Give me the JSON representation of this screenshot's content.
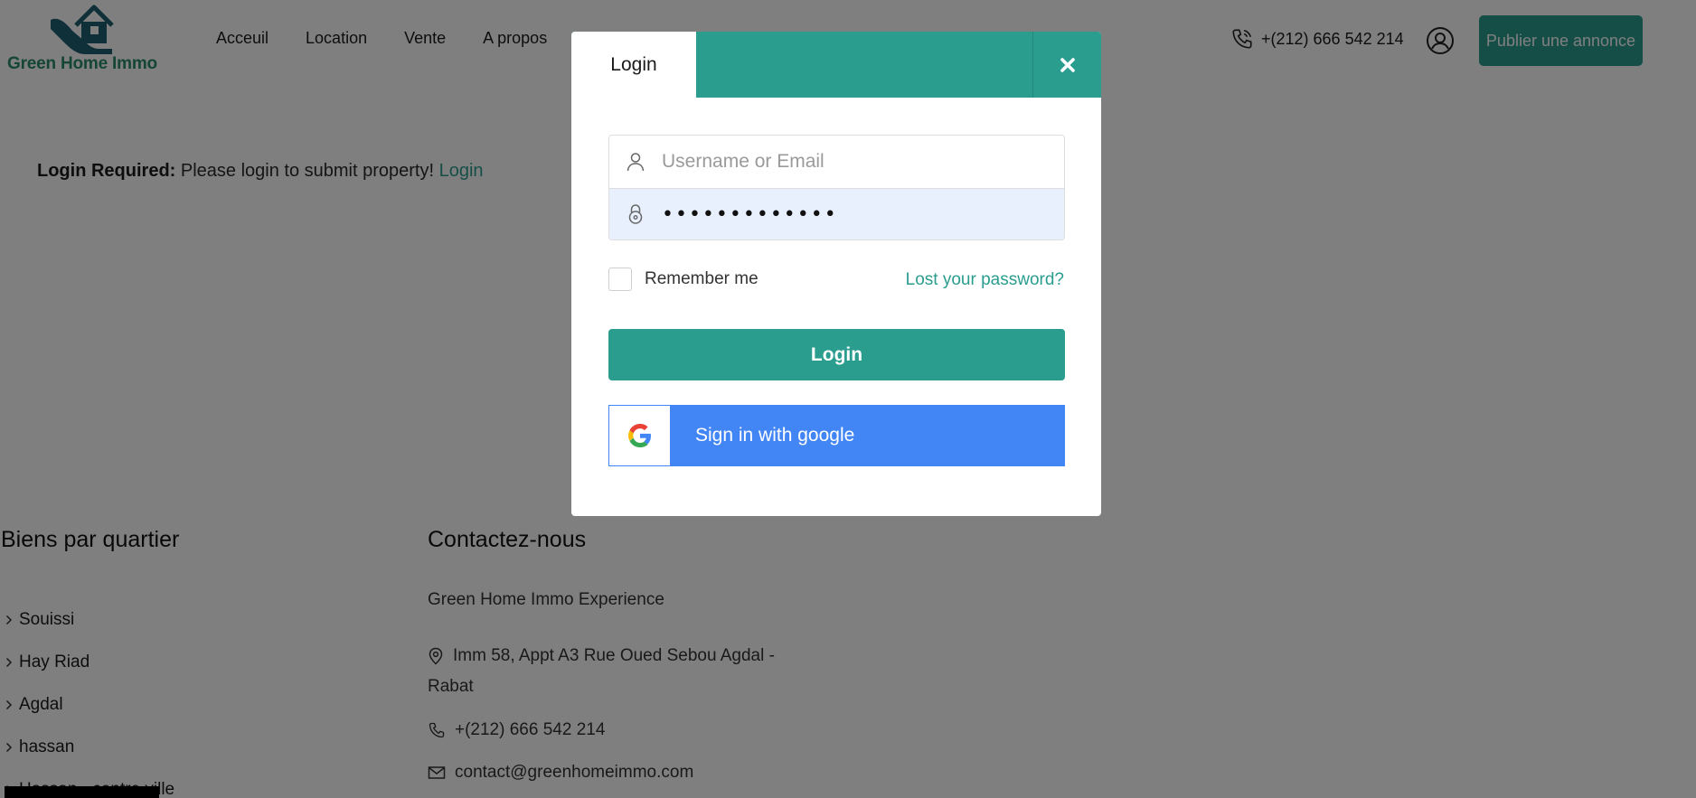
{
  "brand": {
    "name": "Green Home Immo",
    "color": "#2a8a6a",
    "accent": "#2a9d8f",
    "google_blue": "#4285f4"
  },
  "nav": {
    "items": [
      {
        "label": "Acceuil"
      },
      {
        "label": "Location"
      },
      {
        "label": "Vente"
      },
      {
        "label": "A propos"
      }
    ]
  },
  "header": {
    "phone": "+(212) 666 542 214",
    "publish_label": "Publier une annonce"
  },
  "notice": {
    "title": "Login Required:",
    "message": "Please login to submit property!",
    "link": "Login"
  },
  "footer": {
    "quartier_title": "Biens par quartier",
    "quartiers": [
      "Souissi",
      "Hay Riad",
      "Agdal",
      "hassan",
      "Hassan - centre ville"
    ],
    "contact_title": "Contactez-nous",
    "company": "Green Home Immo Experience",
    "address_line1": "Imm 58, Appt A3 Rue Oued Sebou Agdal -",
    "address_line2": "Rabat",
    "phone": "+(212) 666 542 214",
    "email": "contact@greenhomeimmo.com"
  },
  "modal": {
    "tab_label": "Login",
    "username_placeholder": "Username or Email",
    "password_value": "•••••••••••••",
    "remember_label": "Remember me",
    "lost_password": "Lost your password?",
    "login_button": "Login",
    "google_button": "Sign in with google"
  }
}
